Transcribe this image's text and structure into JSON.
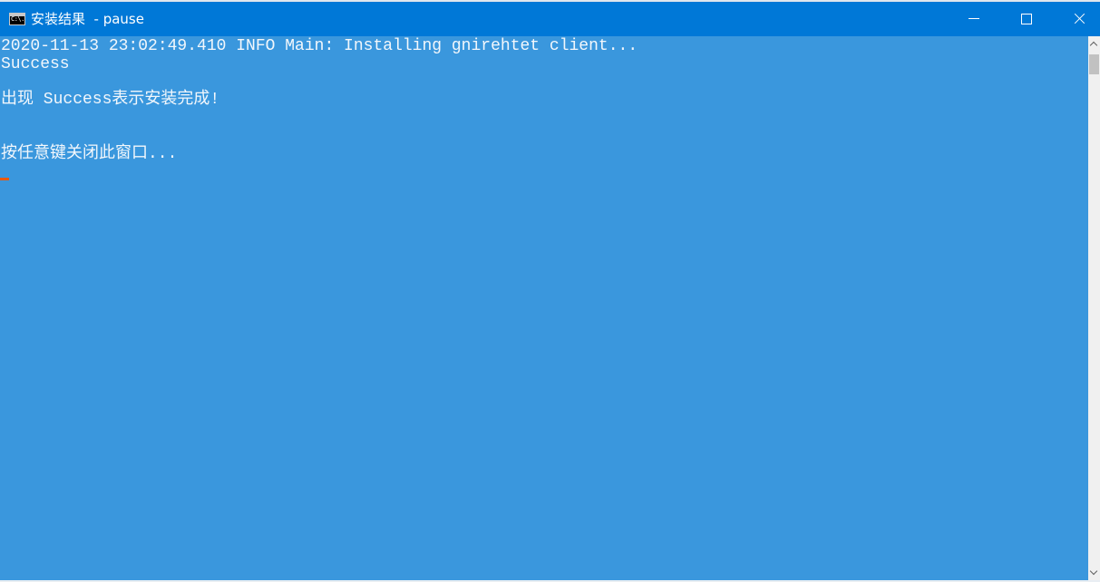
{
  "window": {
    "title": "安装结果  - pause",
    "icon": "console-icon",
    "icon_text": "C:\\.",
    "controls": {
      "minimize": "minimize-icon",
      "maximize": "maximize-icon",
      "close": "close-icon"
    }
  },
  "console": {
    "lines": [
      "2020-11-13 23:02:49.410 INFO Main: Installing gnirehtet client...",
      "Success",
      "出现 Success表示安装完成!",
      "按任意键关闭此窗口..."
    ]
  },
  "colors": {
    "titlebar": "#0078d7",
    "console_background": "#3a97dd",
    "console_text": "#ffffff",
    "cursor": "#e8590c"
  }
}
